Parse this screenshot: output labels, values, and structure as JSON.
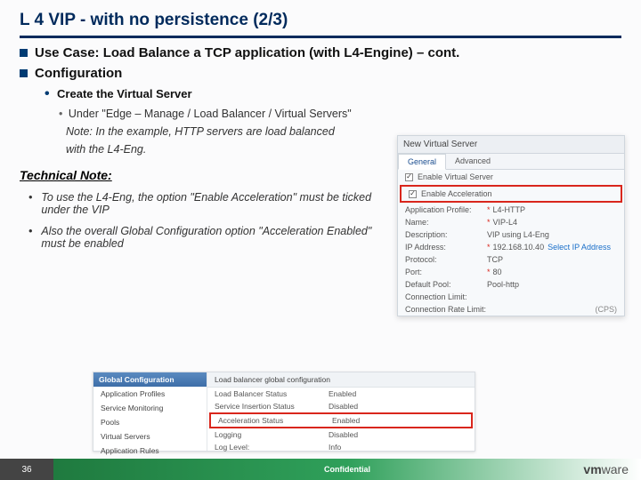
{
  "title": "L 4 VIP - with no persistence (2/3)",
  "sec1": "Use Case: Load Balance a TCP application (with L4-Engine) – cont.",
  "sec2": "Configuration",
  "sub1": "Create the Virtual Server",
  "sub2": "Under \"Edge – Manage / Load Balancer / Virtual Servers\"",
  "note1": "Note: In the example, HTTP servers are load balanced",
  "note2": "with the L4-Eng.",
  "tech": "Technical Note:",
  "bul1": "To use the L4-Eng, the option \"Enable Acceleration\" must be ticked under the VIP",
  "bul2": "Also the overall Global Configuration option \"Acceleration Enabled\" must be enabled",
  "pop": {
    "head": "New Virtual Server",
    "tab1": "General",
    "tab2": "Advanced",
    "c1": "Enable Virtual Server",
    "c2": "Enable Acceleration",
    "f": [
      [
        "Application Profile:",
        "L4-HTTP",
        1
      ],
      [
        "Name:",
        "VIP-L4",
        1
      ],
      [
        "Description:",
        "VIP using L4-Eng",
        0
      ],
      [
        "IP Address:",
        "192.168.10.40",
        1
      ],
      [
        "Protocol:",
        "TCP",
        0
      ],
      [
        "Port:",
        "80",
        1
      ],
      [
        "Default Pool:",
        "Pool-http",
        0
      ],
      [
        "Connection Limit:",
        "",
        0
      ],
      [
        "Connection Rate Limit:",
        "",
        0
      ]
    ],
    "sel": "Select IP Address",
    "cps": "(CPS)"
  },
  "p2": {
    "sh": "Global Configuration",
    "si": [
      "Application Profiles",
      "Service Monitoring",
      "Pools",
      "Virtual Servers",
      "Application Rules"
    ],
    "mh": "Load balancer global configuration",
    "rows": [
      [
        "Load Balancer Status",
        "Enabled"
      ],
      [
        "Service Insertion Status",
        "Disabled"
      ],
      [
        "Acceleration Status",
        "Enabled"
      ],
      [
        "Logging",
        "Disabled"
      ],
      [
        "Log Level:",
        "Info"
      ]
    ]
  },
  "page": "36",
  "conf": "Confidential",
  "brand": "vmware"
}
